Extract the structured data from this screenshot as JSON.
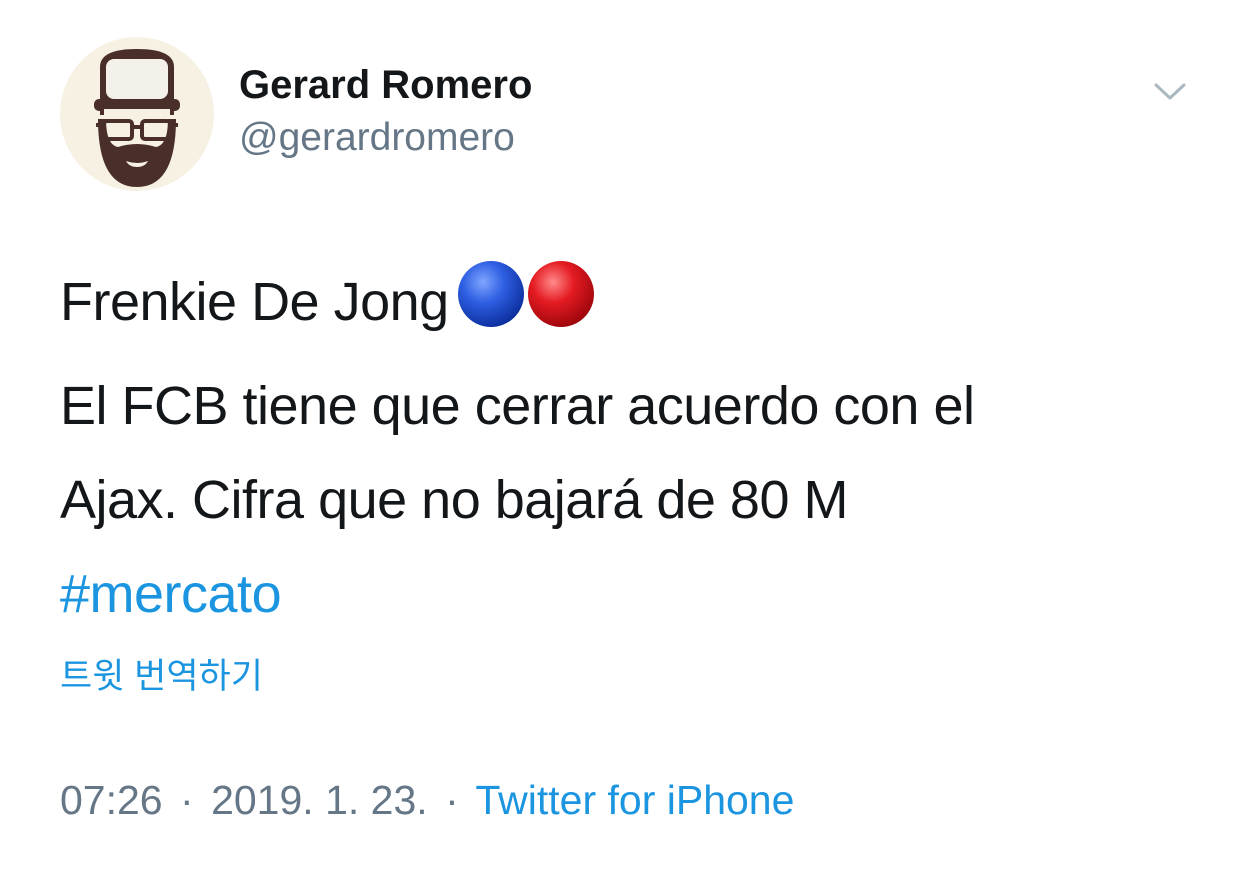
{
  "author": {
    "display_name": "Gerard Romero",
    "handle": "@gerardromero",
    "avatar_icon": "bearded-man-with-cap-glasses-icon"
  },
  "menu": {
    "icon": "chevron-down-icon",
    "color": "#aab8c2"
  },
  "tweet": {
    "line1": "Frenkie De Jong",
    "emoji": [
      "blue-circle",
      "red-circle"
    ],
    "line2": "El FCB tiene que cerrar acuerdo con el",
    "line3": "Ajax. Cifra que no bajará de 80 M",
    "hashtag": "#mercato"
  },
  "translate_label": "트윗 번역하기",
  "meta": {
    "time": "07:26",
    "separator": "·",
    "date": "2019. 1. 23.",
    "source": "Twitter for iPhone"
  },
  "colors": {
    "text": "#14171a",
    "secondary": "#657786",
    "link": "#1b95e0",
    "blue_circle": "#1f4fd6",
    "red_circle": "#e0101c"
  }
}
